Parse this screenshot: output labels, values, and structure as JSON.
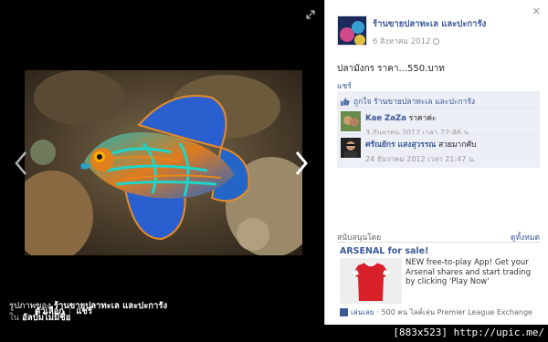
{
  "photo_viewer": {
    "caption_prefix": "รูปภาพของ",
    "caption_owner": "ร้านขายปลาทะเล และปะการัง",
    "caption_album_prefix": "ใน",
    "caption_album": "อัลบั้มไม่มีชื่อ",
    "action_tag": "ตัวเลือก",
    "action_share": "แชร์"
  },
  "panel": {
    "owner_name": "ร้านขายปลาทะเล และปะการัง",
    "post_date": "6 สิงหาคม 2012",
    "post_text": "ปลามังกร ราคา...550.บาท",
    "share_label": "แชร์",
    "likes_text": "ถูกใจ ร้านขายปลาทะเล และปะการัง",
    "comments": [
      {
        "author": "Kae ZaZa",
        "text": "ราคาค่ะ",
        "time": "3 กันยายน 2012 เวลา 22:46 น."
      },
      {
        "author": "ศรัณยักร แสงสุวรรณ",
        "text": "สวยมากคับ",
        "time": "24 ธันวาคม 2012 เวลา 21:47 น."
      }
    ]
  },
  "sponsored": {
    "title": "สนับสนุนโดย",
    "see_all": "ดูทั้งหมด",
    "ad_title": "ARSENAL for sale!",
    "ad_text": "NEW free-to-play App! Get your Arsenal shares and start trading by clicking 'Play Now'",
    "like_label": "เล่นเลย",
    "like_count_text": "· 500 คน ไลค์เล่น Premier League Exchange"
  },
  "watermark": "[883x523] http://upic.me/"
}
